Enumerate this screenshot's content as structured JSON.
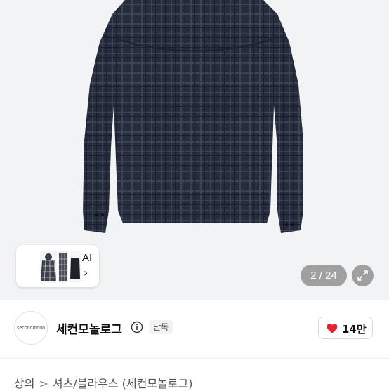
{
  "gallery": {
    "thumbnail_ai_label": "AI",
    "page_counter": "2 / 24",
    "colors": {
      "background": "#f2f3f5",
      "shirt": "#2a3040"
    }
  },
  "shop": {
    "logo_text": "secondmono",
    "name": "세컨모놀로그",
    "badge": "단독",
    "like_count": "14만",
    "heart_color": "#e0282e"
  },
  "breadcrumb": {
    "items": [
      "상의",
      "셔츠/블라우스 (세컨모놀로그)"
    ],
    "separator": ">"
  },
  "icons": [
    "info-icon",
    "heart-icon",
    "expand-icon",
    "chevron-right-icon"
  ]
}
